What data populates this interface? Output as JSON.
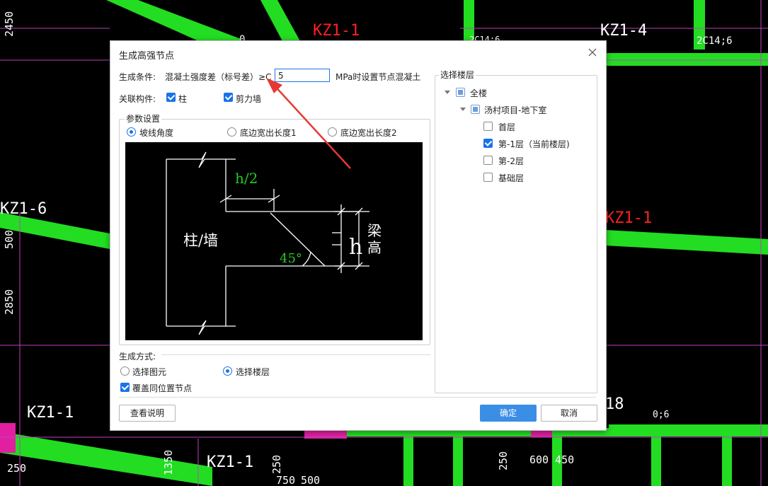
{
  "dialog": {
    "title": "生成高强节点",
    "condition": {
      "label": "生成条件:",
      "text": "混凝土强度差（标号差）≥C",
      "value": "5",
      "suffix": "MPa时设置节点混凝土"
    },
    "related": {
      "label": "关联构件:",
      "items": [
        {
          "label": "柱",
          "checked": true
        },
        {
          "label": "剪力墙",
          "checked": true
        }
      ]
    },
    "params": {
      "title": "参数设置",
      "options": [
        {
          "label": "坡线角度",
          "selected": true
        },
        {
          "label": "底边宽出长度1",
          "selected": false
        },
        {
          "label": "底边宽出长度2",
          "selected": false
        }
      ],
      "diagram": {
        "half_h": "h/2",
        "column_wall": "柱/墙",
        "angle": "45°",
        "h": "h",
        "beam_height_1": "梁",
        "beam_height_2": "高"
      }
    },
    "method": {
      "title": "生成方式:",
      "options": [
        {
          "label": "选择图元",
          "selected": false
        },
        {
          "label": "选择楼层",
          "selected": true
        }
      ],
      "override": {
        "label": "覆盖同位置节点",
        "checked": true
      }
    },
    "floors": {
      "title": "选择楼层",
      "tree": [
        {
          "label": "全楼",
          "state": "partial"
        },
        {
          "label": "汤村项目-地下室",
          "state": "partial"
        },
        {
          "label": "首层",
          "state": "unchecked"
        },
        {
          "label": "第-1层（当前楼层)",
          "state": "checked"
        },
        {
          "label": "第-2层",
          "state": "unchecked"
        },
        {
          "label": "基础层",
          "state": "unchecked"
        }
      ]
    },
    "buttons": {
      "help": "查看说明",
      "ok": "确定",
      "cancel": "取消"
    }
  },
  "cad_labels": {
    "kz1_1_top": "KZ1-1",
    "kz1_4": "KZ1-4",
    "rebar_2c14_6": "2C14;6",
    "rebar_2c14_6_partial": "2C14;6",
    "kz1_6": "KZ1-6",
    "kz1_1_right": "KZ1-1",
    "kz1_1_left": "KZ1-1",
    "kz1_1_bottom": "KZ1-1",
    "dim_2450": "2450",
    "dim_2850": "2850",
    "dim_500_left": "500",
    "dim_250_left": "250",
    "dim_1350": "1350",
    "dim_250_a": "250",
    "dim_250_b": "250",
    "dim_750": "750",
    "dim_500_bottom": "500",
    "dim_600_450": "600 450",
    "rebar_0_6": "0;6",
    "kz18": "18",
    "dim_0_top": "0"
  },
  "colors": {
    "beam_green": "#22dd22",
    "column_magenta": "#e020a0",
    "label_red": "#ff2020",
    "text_white": "#ffffff",
    "diagram_green": "#22cc22",
    "annotation_arrow": "#e53935",
    "accent_blue": "#1a73e8"
  }
}
